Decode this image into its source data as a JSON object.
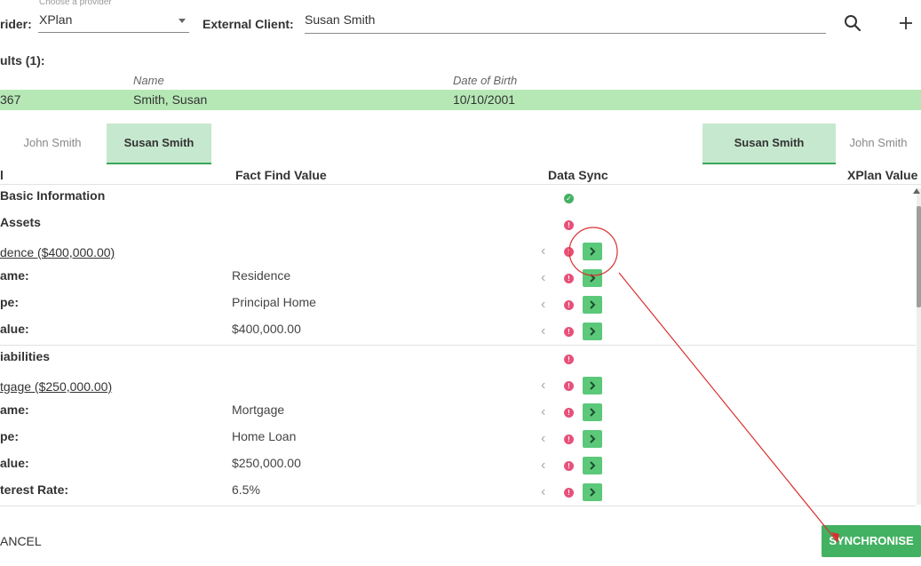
{
  "header": {
    "provider_hint": "Choose a provider",
    "provider_label": "rider:",
    "provider_value": "XPlan",
    "external_client_label": "External Client:",
    "external_client_value": "Susan Smith",
    "search_icon": "search-icon",
    "add_icon": "plus-icon"
  },
  "results": {
    "title": "ults (1):",
    "columns": {
      "name": "Name",
      "dob": "Date of Birth"
    },
    "rows": [
      {
        "id": "367",
        "name": "Smith, Susan",
        "dob": "10/10/2001"
      }
    ]
  },
  "tabs_left": [
    {
      "label": "John Smith",
      "active": false
    },
    {
      "label": "Susan Smith",
      "active": true
    }
  ],
  "tabs_right": [
    {
      "label": "Susan Smith",
      "active": true
    },
    {
      "label": "John Smith",
      "active": false
    }
  ],
  "table": {
    "columns": {
      "field": "l",
      "fact_find": "Fact Find Value",
      "data_sync": "Data Sync",
      "xplan": "XPlan Value"
    },
    "rows": [
      {
        "kind": "section",
        "label": "Basic Information",
        "status": "ok"
      },
      {
        "kind": "section",
        "label": "Assets",
        "status": "error"
      },
      {
        "kind": "link",
        "label": "dence ($400,000.00)",
        "status": "error",
        "highlighted": true
      },
      {
        "kind": "field",
        "label": "ame:",
        "value": "Residence",
        "status": "error"
      },
      {
        "kind": "field",
        "label": "pe:",
        "value": "Principal Home",
        "status": "error"
      },
      {
        "kind": "field",
        "label": "alue:",
        "value": "$400,000.00",
        "status": "error"
      },
      {
        "kind": "section",
        "label": "iabilities",
        "status": "error"
      },
      {
        "kind": "link",
        "label": "tgage ($250,000.00)",
        "status": "error"
      },
      {
        "kind": "field",
        "label": "ame:",
        "value": "Mortgage",
        "status": "error"
      },
      {
        "kind": "field",
        "label": "pe:",
        "value": "Home Loan",
        "status": "error"
      },
      {
        "kind": "field",
        "label": "alue:",
        "value": "$250,000.00",
        "status": "error"
      },
      {
        "kind": "field",
        "label": "terest Rate:",
        "value": "6.5%",
        "status": "error"
      }
    ]
  },
  "footer": {
    "cancel": "ANCEL",
    "synchronise": "SYNCHRONISE"
  },
  "colors": {
    "accent_green": "#43b162",
    "error_pink": "#e8507a",
    "results_green": "#b6e8b6",
    "annotation_red": "#d9302f"
  }
}
